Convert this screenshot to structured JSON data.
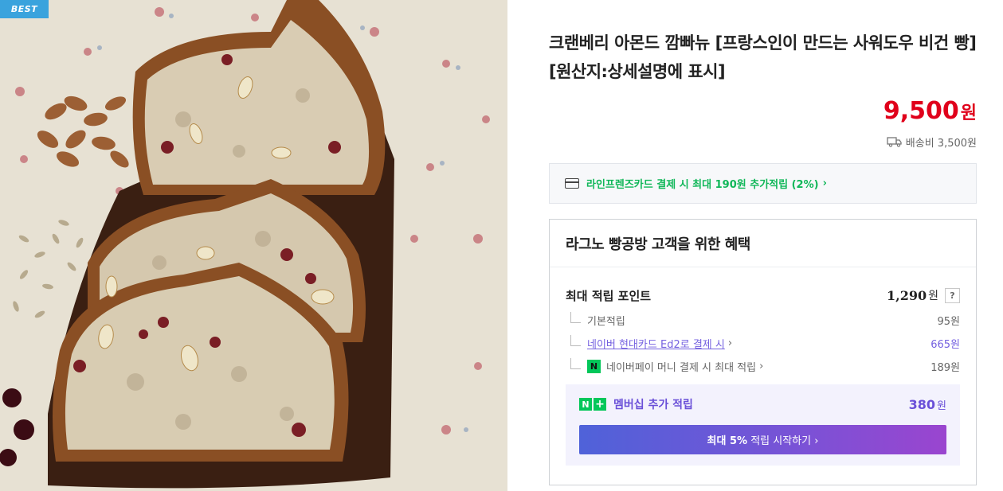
{
  "badge": "BEST",
  "product": {
    "title": "크랜베리 아몬드 깜빠뉴 [프랑스인이 만드는 사워도우 비건 빵] [원산지:상세설명에 표시]",
    "price": "9,500",
    "price_unit": "원",
    "shipping": "배송비 3,500원"
  },
  "card_benefit": {
    "text": "라인프렌즈카드 결제 시 최대 190원 추가적립 (2%)",
    "chevron": "›"
  },
  "benefits": {
    "heading": "라그노 빵공방 고객을 위한 혜택",
    "max_points_label": "최대 적립 포인트",
    "max_points_value": "1,290",
    "max_points_unit": "원",
    "help_label": "?",
    "rows": [
      {
        "label": "기본적립",
        "value": "95원"
      },
      {
        "label": "네이버 현대카드 Ed2로 결제 시",
        "value": "665원"
      },
      {
        "label": "네이버페이 머니 결제 시 최대 적립",
        "value": "189원",
        "icon": "N"
      }
    ],
    "membership": {
      "badge_n": "N",
      "badge_plus": "+",
      "label": "멤버십 추가 적립",
      "value": "380",
      "unit": "원",
      "cta_bold": "최대 5%",
      "cta_rest": " 적립 시작하기 ›"
    }
  },
  "colors": {
    "price_red": "#e0001b",
    "naver_green": "#03c75a",
    "card_green": "#10b759",
    "purple": "#6a50d8",
    "badge_blue": "#3aa3dd"
  },
  "icons": [
    "truck-icon",
    "credit-card-icon",
    "naverpay-icon",
    "naver-plus-icon",
    "chevron-right-icon",
    "help-icon"
  ]
}
